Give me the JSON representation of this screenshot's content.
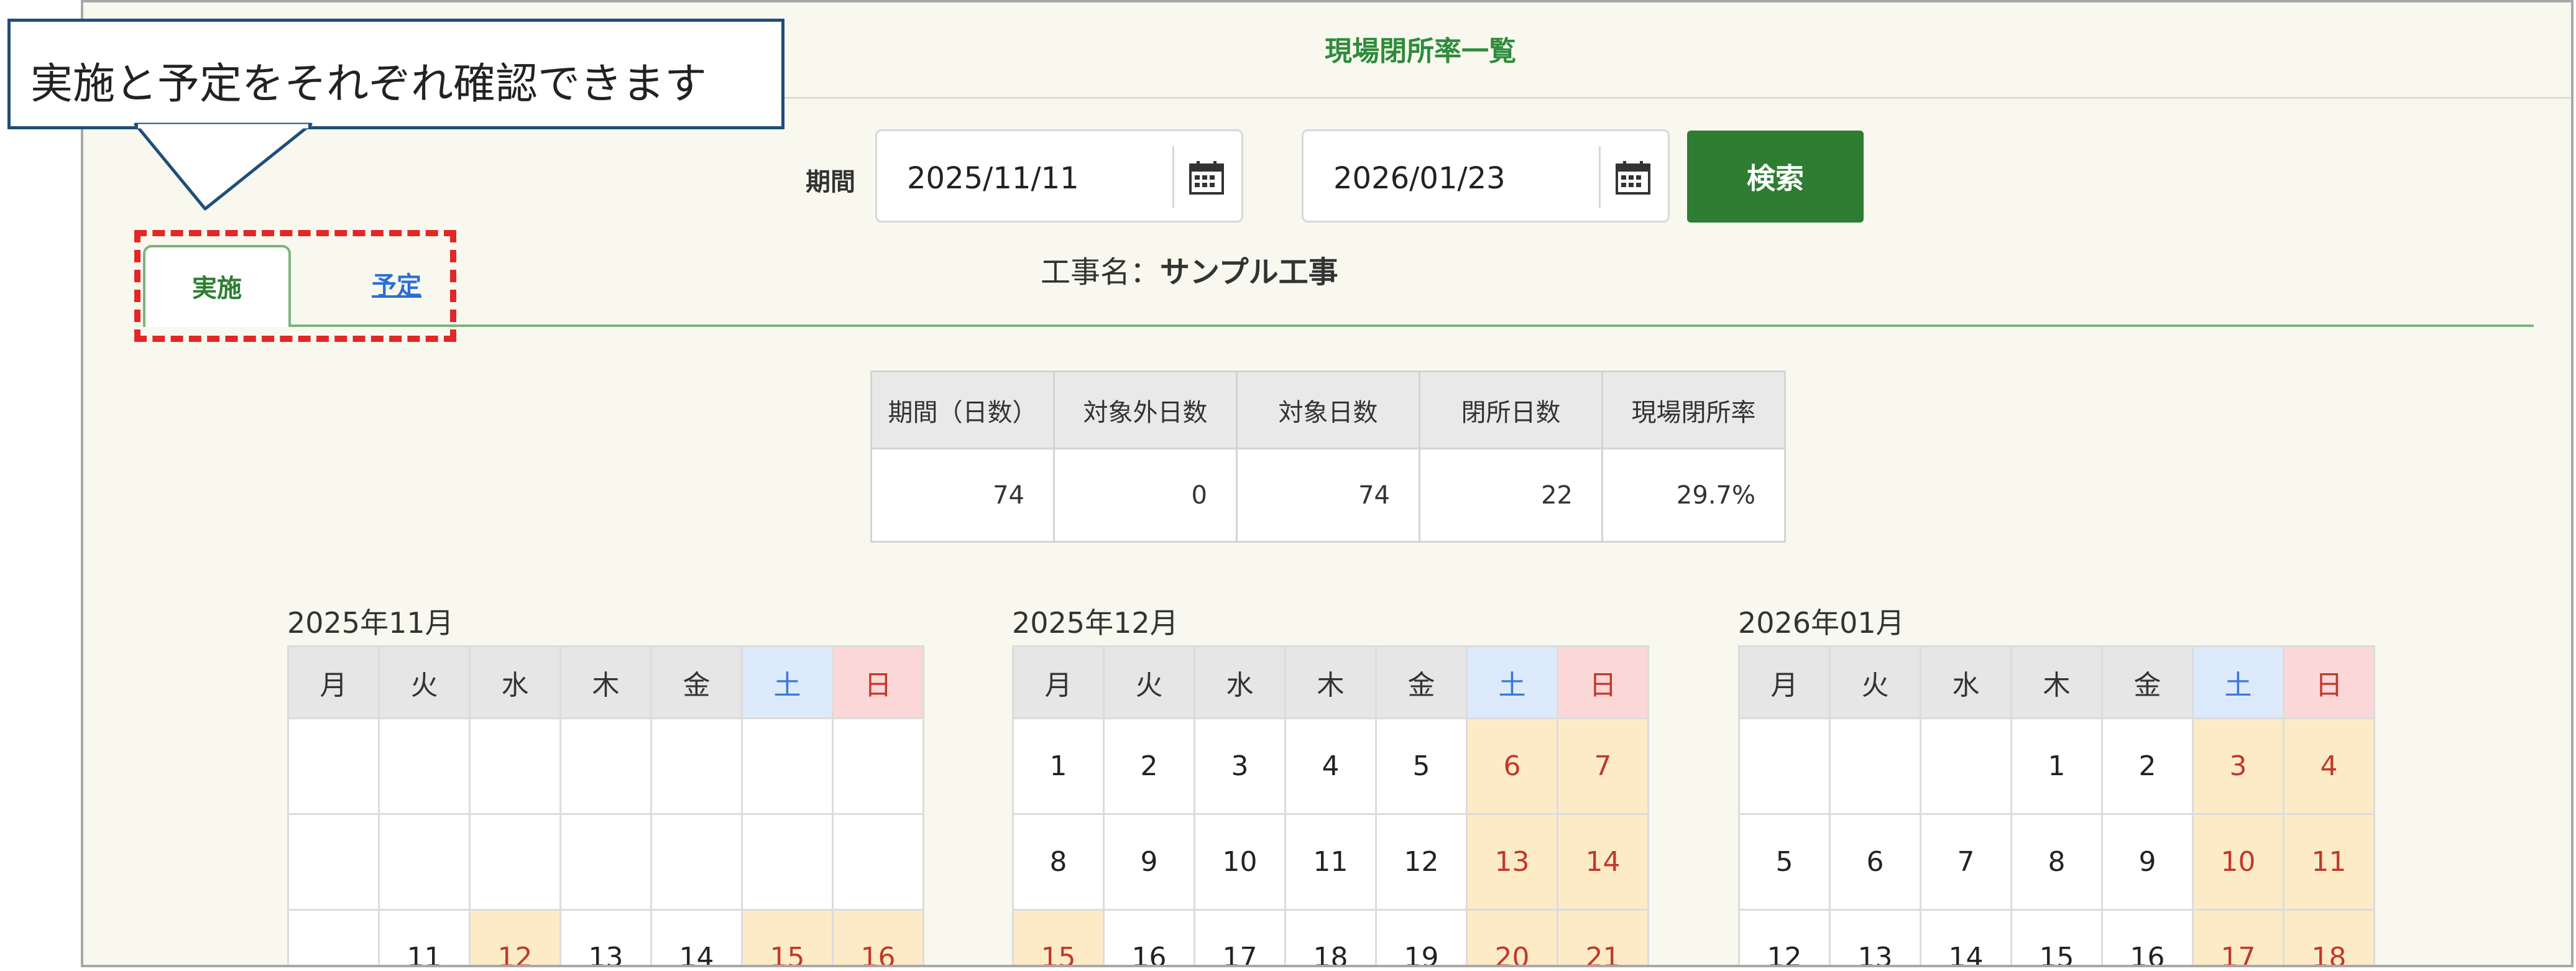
{
  "page": {
    "title": "現場閉所率一覧",
    "period_label": "期間",
    "date_from": "2025/11/11",
    "date_to": "2026/01/23",
    "tilde": "～",
    "search_label": "検索",
    "project_prefix": "工事名：",
    "project_name": "サンプル工事"
  },
  "tabs": {
    "actual": "実施",
    "planned": "予定",
    "active": "actual"
  },
  "summary": {
    "headers": [
      "期間（日数）",
      "対象外日数",
      "対象日数",
      "閉所日数",
      "現場閉所率"
    ],
    "values": [
      "74",
      "0",
      "74",
      "22",
      "29.7%"
    ]
  },
  "calendars": [
    {
      "title": "2025年11月",
      "weekdays": [
        "月",
        "火",
        "水",
        "木",
        "金",
        "土",
        "日"
      ],
      "rows": [
        [
          {
            "d": ""
          },
          {
            "d": ""
          },
          {
            "d": ""
          },
          {
            "d": ""
          },
          {
            "d": ""
          },
          {
            "d": ""
          },
          {
            "d": ""
          }
        ],
        [
          {
            "d": ""
          },
          {
            "d": ""
          },
          {
            "d": ""
          },
          {
            "d": ""
          },
          {
            "d": ""
          },
          {
            "d": ""
          },
          {
            "d": ""
          }
        ],
        [
          {
            "d": ""
          },
          {
            "d": "11"
          },
          {
            "d": "12",
            "h": true
          },
          {
            "d": "13"
          },
          {
            "d": "14"
          },
          {
            "d": "15",
            "h": true
          },
          {
            "d": "16",
            "h": true
          }
        ]
      ]
    },
    {
      "title": "2025年12月",
      "weekdays": [
        "月",
        "火",
        "水",
        "木",
        "金",
        "土",
        "日"
      ],
      "rows": [
        [
          {
            "d": "1"
          },
          {
            "d": "2"
          },
          {
            "d": "3"
          },
          {
            "d": "4"
          },
          {
            "d": "5"
          },
          {
            "d": "6",
            "h": true
          },
          {
            "d": "7",
            "h": true
          }
        ],
        [
          {
            "d": "8"
          },
          {
            "d": "9"
          },
          {
            "d": "10"
          },
          {
            "d": "11"
          },
          {
            "d": "12"
          },
          {
            "d": "13",
            "h": true
          },
          {
            "d": "14",
            "h": true
          }
        ],
        [
          {
            "d": "15",
            "h": true
          },
          {
            "d": "16"
          },
          {
            "d": "17"
          },
          {
            "d": "18"
          },
          {
            "d": "19"
          },
          {
            "d": "20",
            "h": true
          },
          {
            "d": "21",
            "h": true
          }
        ]
      ]
    },
    {
      "title": "2026年01月",
      "weekdays": [
        "月",
        "火",
        "水",
        "木",
        "金",
        "土",
        "日"
      ],
      "rows": [
        [
          {
            "d": ""
          },
          {
            "d": ""
          },
          {
            "d": ""
          },
          {
            "d": "1"
          },
          {
            "d": "2"
          },
          {
            "d": "3",
            "h": true
          },
          {
            "d": "4",
            "h": true
          }
        ],
        [
          {
            "d": "5"
          },
          {
            "d": "6"
          },
          {
            "d": "7"
          },
          {
            "d": "8"
          },
          {
            "d": "9"
          },
          {
            "d": "10",
            "h": true
          },
          {
            "d": "11",
            "h": true
          }
        ],
        [
          {
            "d": "12"
          },
          {
            "d": "13"
          },
          {
            "d": "14"
          },
          {
            "d": "15"
          },
          {
            "d": "16"
          },
          {
            "d": "17",
            "h": true
          },
          {
            "d": "18",
            "h": true
          }
        ]
      ]
    }
  ],
  "callout": {
    "text": "実施と予定をそれぞれ確認できます"
  },
  "colors": {
    "accent": "#2e7d32",
    "title_green": "#2e8b3a",
    "holiday_bg": "#fdebc8",
    "holiday_text": "#c0392b",
    "saturday_header": "#ddeafb",
    "sunday_header": "#fbd7d7",
    "highlight": "#e32626",
    "callout_border": "#1f4e79"
  }
}
